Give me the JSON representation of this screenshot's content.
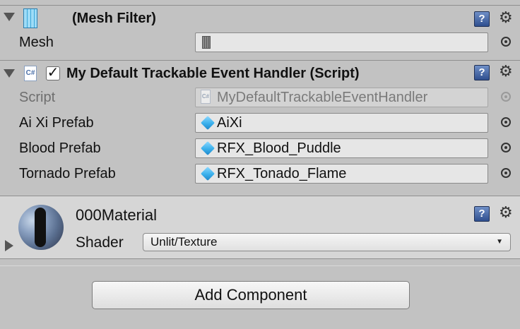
{
  "mesh_filter": {
    "title": "(Mesh Filter)",
    "mesh_label": "Mesh",
    "mesh_value": ""
  },
  "script_component": {
    "title": "My Default Trackable Event Handler (Script)",
    "enabled": true,
    "check_glyph": "✓",
    "fields": [
      {
        "label": "Script",
        "value": "MyDefaultTrackableEventHandler",
        "icon": "csharp-script-icon",
        "disabled": true
      },
      {
        "label": "Ai Xi Prefab",
        "value": "AiXi",
        "icon": "prefab-cube-icon",
        "disabled": false
      },
      {
        "label": "Blood Prefab",
        "value": "RFX_Blood_Puddle",
        "icon": "prefab-cube-icon",
        "disabled": false
      },
      {
        "label": "Tornado Prefab",
        "value": "RFX_Tonado_Flame",
        "icon": "prefab-cube-icon",
        "disabled": false
      }
    ]
  },
  "material": {
    "name": "000Material",
    "shader_label": "Shader",
    "shader_value": "Unlit/Texture"
  },
  "add_component_label": "Add Component",
  "icons": {
    "help": "?",
    "gear": "⚙",
    "cs": "C#",
    "dropdown_arrow": "▼"
  }
}
